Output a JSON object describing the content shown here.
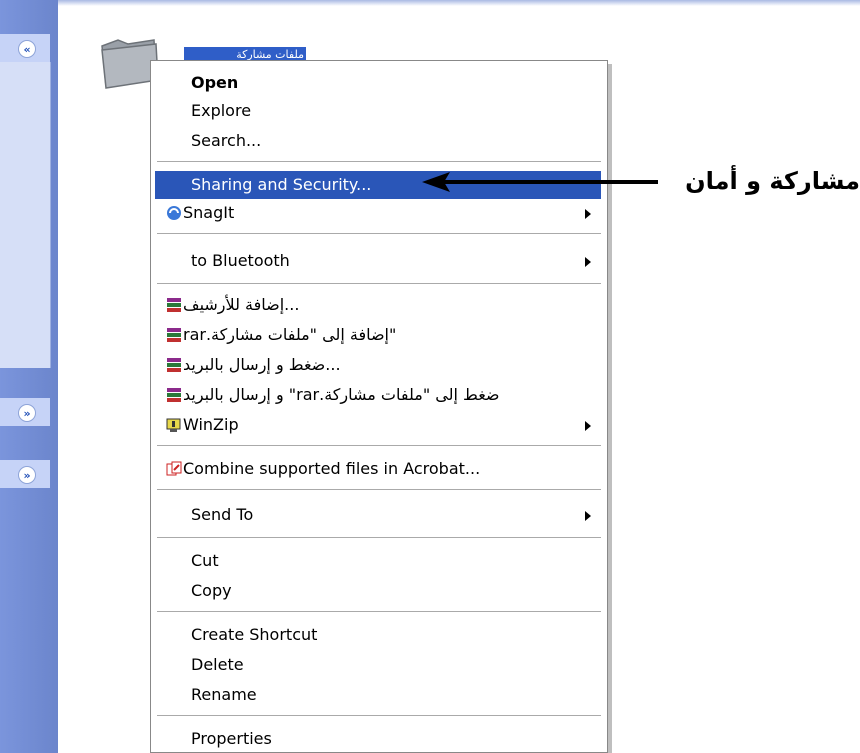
{
  "folder": {
    "name": "ملفات مشاركة"
  },
  "task_pane": {
    "toggle_top": "«",
    "toggle_mid": "»",
    "toggle_bottom": "»"
  },
  "menu": {
    "open": "Open",
    "explore": "Explore",
    "search": "Search...",
    "sharing_security": "Sharing and Security...",
    "snagit": "SnagIt",
    "bluetooth": "to Bluetooth",
    "rar_add_archive": "...إضافة للأرشيف",
    "rar_add_named": "\"إضافة إلى \"ملفات مشاركة.rar",
    "rar_compress_email": "...ضغط و إرسال بالبريد",
    "rar_compress_named_email": "ضغط إلى \"ملفات مشاركة.rar\" و إرسال بالبريد",
    "winzip": "WinZip",
    "acrobat": "Combine supported files in Acrobat...",
    "send_to": "Send To",
    "cut": "Cut",
    "copy": "Copy",
    "create_shortcut": "Create Shortcut",
    "delete": "Delete",
    "rename": "Rename",
    "properties": "Properties"
  },
  "annotation": {
    "text": "مشاركة و أمان"
  },
  "colors": {
    "highlight": "#2a56b8",
    "task_pane": "#7b93d3",
    "folder": "#9aa0a8"
  }
}
